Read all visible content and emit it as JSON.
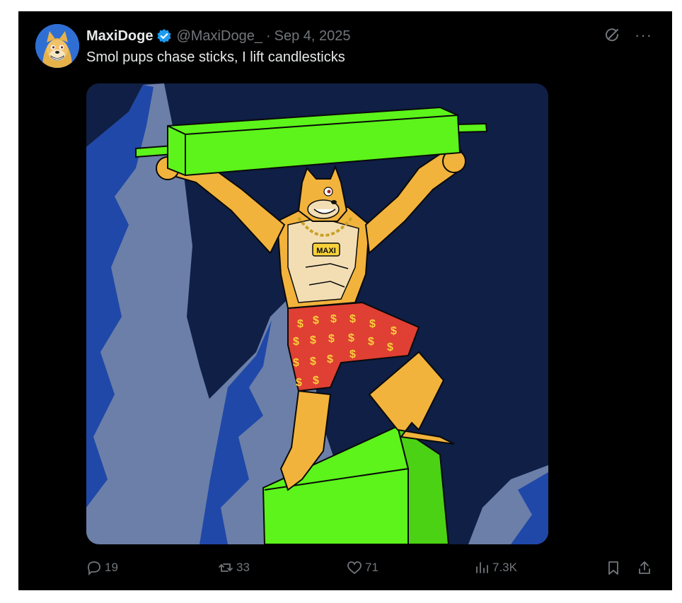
{
  "tweet": {
    "author_name": "MaxiDoge",
    "handle": "@MaxiDoge_",
    "separator": "·",
    "date": "Sep 4, 2025",
    "text": "Smol pups chase sticks, I lift candlesticks",
    "more_label": "···",
    "badge_text": "MAXI",
    "icons": {
      "verified": "verified-badge-icon",
      "grok": "grok-icon",
      "more": "more-options-icon",
      "reply": "reply-icon",
      "repost": "repost-icon",
      "like": "like-icon",
      "views": "views-icon",
      "bookmark": "bookmark-icon",
      "share": "share-icon"
    },
    "stats": {
      "replies": "19",
      "reposts": "33",
      "likes": "71",
      "views": "7.3K"
    },
    "colors": {
      "background": "#000000",
      "text": "#e7e9ea",
      "secondary": "#71767b",
      "verified": "#1d9bf0",
      "candle_green": "#5cf41a"
    }
  }
}
